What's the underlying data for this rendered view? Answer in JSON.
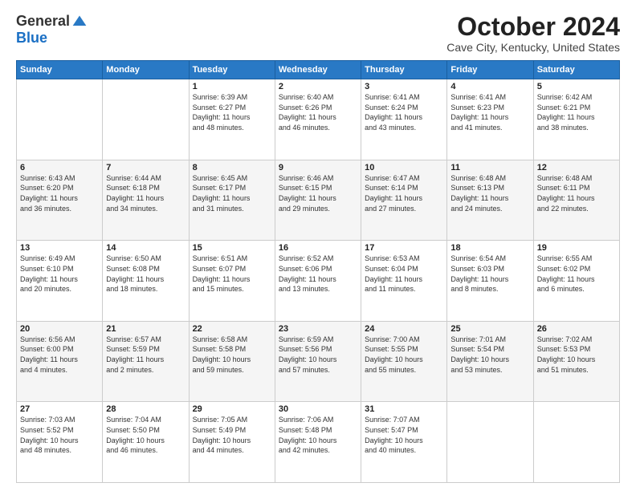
{
  "logo": {
    "general": "General",
    "blue": "Blue"
  },
  "title": "October 2024",
  "location": "Cave City, Kentucky, United States",
  "days_of_week": [
    "Sunday",
    "Monday",
    "Tuesday",
    "Wednesday",
    "Thursday",
    "Friday",
    "Saturday"
  ],
  "weeks": [
    [
      {
        "day": "",
        "info": ""
      },
      {
        "day": "",
        "info": ""
      },
      {
        "day": "1",
        "info": "Sunrise: 6:39 AM\nSunset: 6:27 PM\nDaylight: 11 hours\nand 48 minutes."
      },
      {
        "day": "2",
        "info": "Sunrise: 6:40 AM\nSunset: 6:26 PM\nDaylight: 11 hours\nand 46 minutes."
      },
      {
        "day": "3",
        "info": "Sunrise: 6:41 AM\nSunset: 6:24 PM\nDaylight: 11 hours\nand 43 minutes."
      },
      {
        "day": "4",
        "info": "Sunrise: 6:41 AM\nSunset: 6:23 PM\nDaylight: 11 hours\nand 41 minutes."
      },
      {
        "day": "5",
        "info": "Sunrise: 6:42 AM\nSunset: 6:21 PM\nDaylight: 11 hours\nand 38 minutes."
      }
    ],
    [
      {
        "day": "6",
        "info": "Sunrise: 6:43 AM\nSunset: 6:20 PM\nDaylight: 11 hours\nand 36 minutes."
      },
      {
        "day": "7",
        "info": "Sunrise: 6:44 AM\nSunset: 6:18 PM\nDaylight: 11 hours\nand 34 minutes."
      },
      {
        "day": "8",
        "info": "Sunrise: 6:45 AM\nSunset: 6:17 PM\nDaylight: 11 hours\nand 31 minutes."
      },
      {
        "day": "9",
        "info": "Sunrise: 6:46 AM\nSunset: 6:15 PM\nDaylight: 11 hours\nand 29 minutes."
      },
      {
        "day": "10",
        "info": "Sunrise: 6:47 AM\nSunset: 6:14 PM\nDaylight: 11 hours\nand 27 minutes."
      },
      {
        "day": "11",
        "info": "Sunrise: 6:48 AM\nSunset: 6:13 PM\nDaylight: 11 hours\nand 24 minutes."
      },
      {
        "day": "12",
        "info": "Sunrise: 6:48 AM\nSunset: 6:11 PM\nDaylight: 11 hours\nand 22 minutes."
      }
    ],
    [
      {
        "day": "13",
        "info": "Sunrise: 6:49 AM\nSunset: 6:10 PM\nDaylight: 11 hours\nand 20 minutes."
      },
      {
        "day": "14",
        "info": "Sunrise: 6:50 AM\nSunset: 6:08 PM\nDaylight: 11 hours\nand 18 minutes."
      },
      {
        "day": "15",
        "info": "Sunrise: 6:51 AM\nSunset: 6:07 PM\nDaylight: 11 hours\nand 15 minutes."
      },
      {
        "day": "16",
        "info": "Sunrise: 6:52 AM\nSunset: 6:06 PM\nDaylight: 11 hours\nand 13 minutes."
      },
      {
        "day": "17",
        "info": "Sunrise: 6:53 AM\nSunset: 6:04 PM\nDaylight: 11 hours\nand 11 minutes."
      },
      {
        "day": "18",
        "info": "Sunrise: 6:54 AM\nSunset: 6:03 PM\nDaylight: 11 hours\nand 8 minutes."
      },
      {
        "day": "19",
        "info": "Sunrise: 6:55 AM\nSunset: 6:02 PM\nDaylight: 11 hours\nand 6 minutes."
      }
    ],
    [
      {
        "day": "20",
        "info": "Sunrise: 6:56 AM\nSunset: 6:00 PM\nDaylight: 11 hours\nand 4 minutes."
      },
      {
        "day": "21",
        "info": "Sunrise: 6:57 AM\nSunset: 5:59 PM\nDaylight: 11 hours\nand 2 minutes."
      },
      {
        "day": "22",
        "info": "Sunrise: 6:58 AM\nSunset: 5:58 PM\nDaylight: 10 hours\nand 59 minutes."
      },
      {
        "day": "23",
        "info": "Sunrise: 6:59 AM\nSunset: 5:56 PM\nDaylight: 10 hours\nand 57 minutes."
      },
      {
        "day": "24",
        "info": "Sunrise: 7:00 AM\nSunset: 5:55 PM\nDaylight: 10 hours\nand 55 minutes."
      },
      {
        "day": "25",
        "info": "Sunrise: 7:01 AM\nSunset: 5:54 PM\nDaylight: 10 hours\nand 53 minutes."
      },
      {
        "day": "26",
        "info": "Sunrise: 7:02 AM\nSunset: 5:53 PM\nDaylight: 10 hours\nand 51 minutes."
      }
    ],
    [
      {
        "day": "27",
        "info": "Sunrise: 7:03 AM\nSunset: 5:52 PM\nDaylight: 10 hours\nand 48 minutes."
      },
      {
        "day": "28",
        "info": "Sunrise: 7:04 AM\nSunset: 5:50 PM\nDaylight: 10 hours\nand 46 minutes."
      },
      {
        "day": "29",
        "info": "Sunrise: 7:05 AM\nSunset: 5:49 PM\nDaylight: 10 hours\nand 44 minutes."
      },
      {
        "day": "30",
        "info": "Sunrise: 7:06 AM\nSunset: 5:48 PM\nDaylight: 10 hours\nand 42 minutes."
      },
      {
        "day": "31",
        "info": "Sunrise: 7:07 AM\nSunset: 5:47 PM\nDaylight: 10 hours\nand 40 minutes."
      },
      {
        "day": "",
        "info": ""
      },
      {
        "day": "",
        "info": ""
      }
    ]
  ]
}
